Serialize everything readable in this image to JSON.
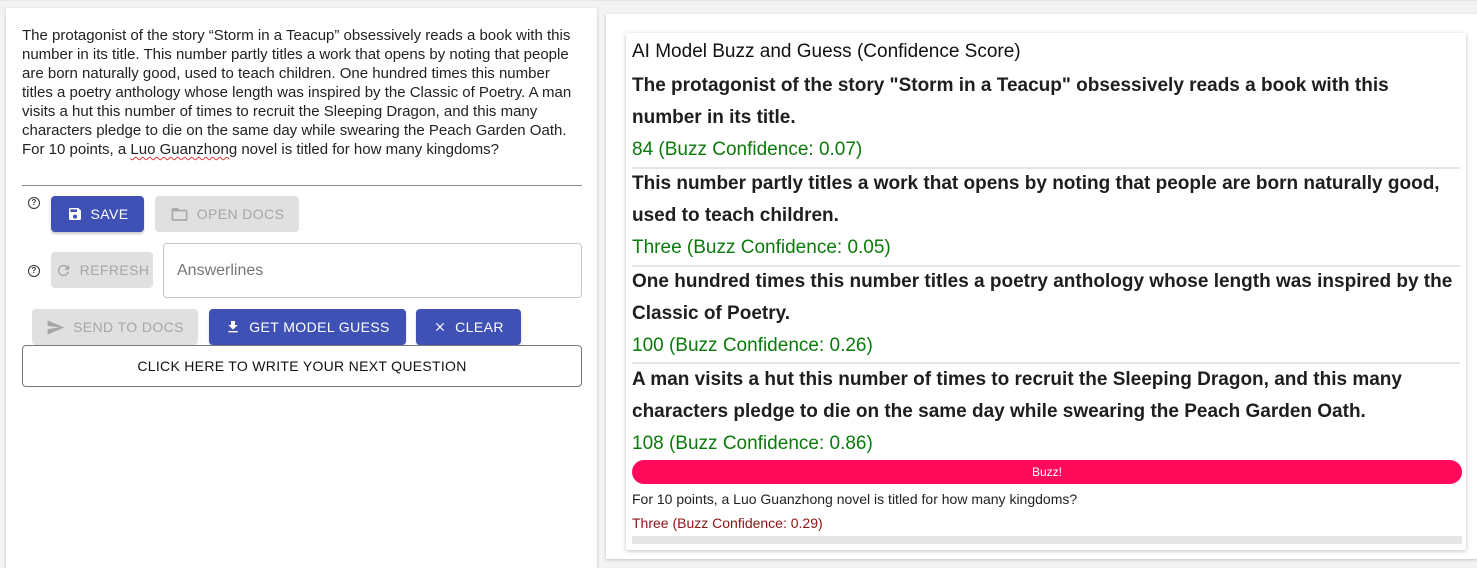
{
  "editor": {
    "question_before": "The protagonist of the story “Storm in a Teacup” obsessively reads a book with this number in its title. This number partly titles a work that opens by noting that people are born naturally good, used to teach children. One hundred times this number titles a poetry anthology whose length was inspired by the Classic of Poetry. A man visits a hut this number of times to recruit the Sleeping Dragon, and this many characters pledge to die on the same day while swearing the Peach Garden Oath. For 10 points, a ",
    "question_misspelled": "Luo Guanzhong",
    "question_after": " novel is titled for how many kingdoms?",
    "help_glyph": "?",
    "save_label": "SAVE",
    "open_docs_label": "OPEN DOCS",
    "refresh_label": "REFRESH",
    "answerlines_placeholder": "Answerlines",
    "send_to_docs_label": "SEND TO DOCS",
    "get_model_guess_label": "GET MODEL GUESS",
    "clear_label": "CLEAR",
    "write_next_label": "CLICK HERE TO WRITE YOUR NEXT QUESTION"
  },
  "model_panel": {
    "title": "AI Model Buzz and Guess (Confidence Score)",
    "clues": [
      {
        "text": "The protagonist of the story \"Storm in a Teacup\" obsessively reads a book with this number in its title.",
        "guess": "84 (Buzz Confidence: 0.07)"
      },
      {
        "text": "This number partly titles a work that opens by noting that people are born naturally good, used to teach children.",
        "guess": "Three (Buzz Confidence: 0.05)"
      },
      {
        "text": "One hundred times this number titles a poetry anthology whose length was inspired by the Classic of Poetry.",
        "guess": "100 (Buzz Confidence: 0.26)"
      },
      {
        "text": "A man visits a hut this number of times to recruit the Sleeping Dragon, and this many characters pledge to die on the same day while swearing the Peach Garden Oath.",
        "guess": "108 (Buzz Confidence: 0.86)"
      }
    ],
    "buzz_label": "Buzz!",
    "final_clue": "For 10 points, a Luo Guanzhong novel is titled for how many kingdoms?",
    "final_guess": "Three (Buzz Confidence: 0.29)",
    "colors": {
      "guess": "#0a7a0a",
      "final_guess": "#8a1414",
      "buzz": "#ff0a5a",
      "primary_button": "#3f51b5"
    }
  },
  "icons": [
    "help-icon",
    "save-icon",
    "folder-icon",
    "refresh-icon",
    "send-icon",
    "download-icon",
    "close-icon"
  ]
}
